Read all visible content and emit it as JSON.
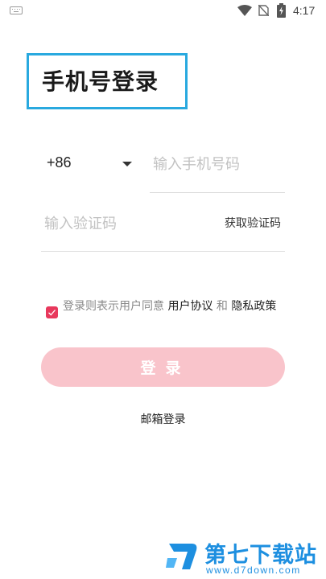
{
  "status_bar": {
    "time": "4:17",
    "icons": [
      "keyboard-icon",
      "wifi-icon",
      "no-sim-icon",
      "battery-charging-icon"
    ]
  },
  "title": "手机号登录",
  "phone": {
    "country_code": "+86",
    "placeholder": "输入手机号码",
    "value": ""
  },
  "code": {
    "placeholder": "输入验证码",
    "value": "",
    "get_code_label": "获取验证码"
  },
  "agreement": {
    "checked": true,
    "prefix": "登录则表示用户同意 ",
    "terms_label": "用户协议",
    "joiner": " 和 ",
    "privacy_label": "隐私政策"
  },
  "login_button_label": "登录",
  "email_login_label": "邮箱登录",
  "watermark": {
    "name": "第七下载站",
    "url": "www.d7down.com"
  },
  "colors": {
    "title_highlight": "#29a9df",
    "accent": "#e8385c",
    "login_button_bg": "#f9c4cb",
    "watermark": "#1d8fe0"
  }
}
